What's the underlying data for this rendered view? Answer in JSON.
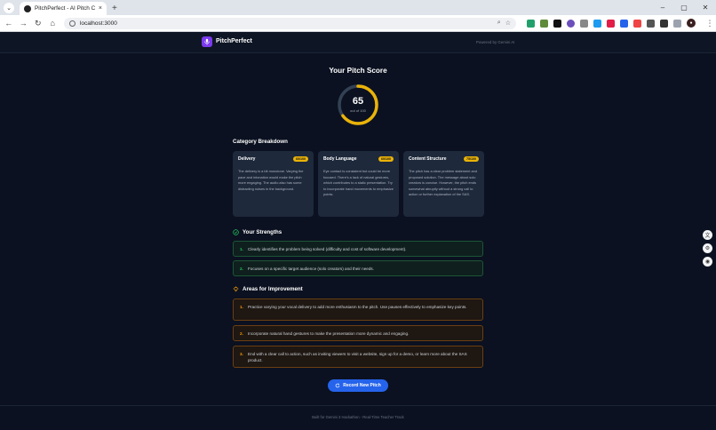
{
  "browser": {
    "tab_title": "PitchPerfect - AI Pitch Coach",
    "url": "localhost:3000",
    "new_tab": "+",
    "close": "×"
  },
  "header": {
    "app_name": "PitchPerfect",
    "powered_by": "Powered by Gemini AI"
  },
  "score": {
    "title": "Your Pitch Score",
    "value": "65",
    "out_of": "out of 100",
    "fraction": 0.65,
    "ring_color": "#eab308"
  },
  "breakdown": {
    "title": "Category Breakdown",
    "categories": [
      {
        "name": "Delivery",
        "score": "60/100",
        "text": "The delivery is a bit monotone. Varying the pace and intonation would make the pitch more engaging. The audio also has some distracting noises in the background."
      },
      {
        "name": "Body Language",
        "score": "60/100",
        "text": "Eye contact is consistent but could be more focused. There's a lack of natural gestures, which contributes to a static presentation. Try to incorporate hand movements to emphasize points."
      },
      {
        "name": "Content Structure",
        "score": "75/100",
        "text": "The pitch has a clear problem statement and proposed solution. The message about solo creators is concise. However, the pitch ends somewhat abruptly without a strong call to action or further explanation of the SAS."
      }
    ]
  },
  "strengths": {
    "title": "Your Strengths",
    "items": [
      {
        "num": "1.",
        "text": "Clearly identifies the problem being solved (difficulty and cost of software development)."
      },
      {
        "num": "2.",
        "text": "Focuses on a specific target audience (solo creators) and their needs."
      }
    ]
  },
  "improvements": {
    "title": "Areas for Improvement",
    "items": [
      {
        "num": "1.",
        "text": "Practice varying your vocal delivery to add more enthusiasm to the pitch. Use pauses effectively to emphasize key points."
      },
      {
        "num": "2.",
        "text": "Incorporate natural hand gestures to make the presentation more dynamic and engaging."
      },
      {
        "num": "3.",
        "text": "End with a clear call to action, such as inviting viewers to visit a website, sign up for a demo, or learn more about the SAS product."
      }
    ]
  },
  "record_button": "Record New Pitch",
  "footer": "Built for Gemini 3 Hackathon - Real-Time Teacher Track",
  "colors": {
    "accent": "#2563eb",
    "brand": "#7c3aed",
    "strength": "#22c55e",
    "improvement": "#f59e0b"
  }
}
